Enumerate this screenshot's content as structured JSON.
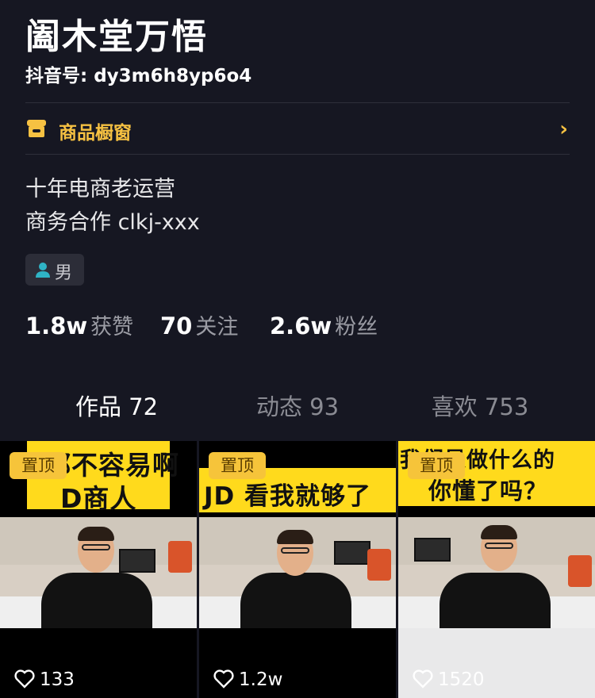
{
  "profile": {
    "name": "阖木堂万悟",
    "douyin_id": "抖音号: dy3m6h8yp6o4",
    "shop_label": "商品橱窗",
    "bio_line1": "十年电商老运营",
    "bio_line2": "商务合作 clkj-xxx",
    "gender": "男",
    "stats": [
      {
        "num": "1.8w",
        "label": "获赞"
      },
      {
        "num": "70",
        "label": "关注"
      },
      {
        "num": "2.6w",
        "label": "粉丝"
      }
    ]
  },
  "tabs": [
    {
      "label": "作品 72"
    },
    {
      "label": "动态 93"
    },
    {
      "label": "喜欢 753"
    }
  ],
  "videos": [
    {
      "pin": "置顶",
      "caption_top": "都不容易啊",
      "caption_bottom": "D商人",
      "likes": "133"
    },
    {
      "pin": "置顶",
      "caption_top": "JD 看我就够了",
      "caption_bottom": "",
      "likes": "1.2w"
    },
    {
      "pin": "置顶",
      "caption_top": "我们是做什么的",
      "caption_bottom": "你懂了吗？",
      "likes": "1520"
    }
  ],
  "colors": {
    "background": "#161722",
    "accent": "#F6C142",
    "caption_yellow": "#FFDA1C"
  },
  "icons": {
    "shop": "shop-icon",
    "chevron": "chevron-right-icon",
    "gender": "person-icon",
    "like": "heart-outline-icon"
  }
}
